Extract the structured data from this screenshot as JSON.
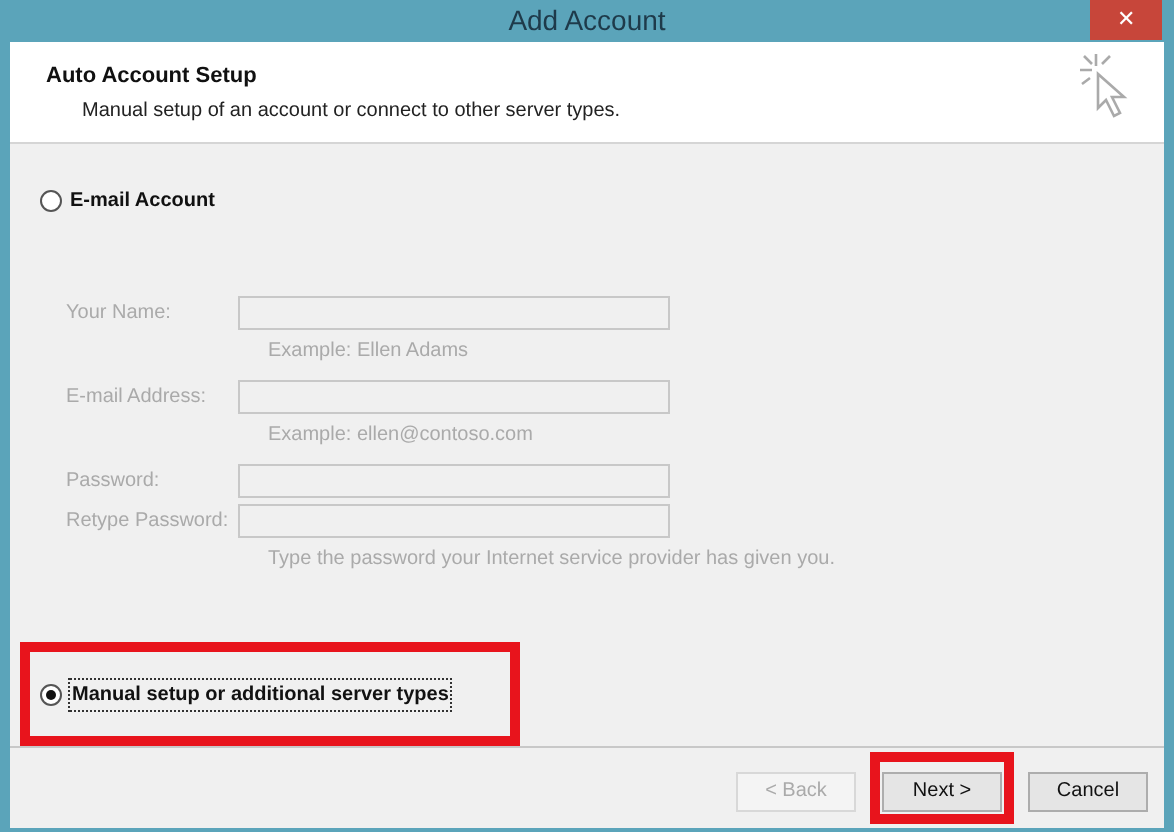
{
  "window": {
    "title": "Add Account",
    "close_label": "✕"
  },
  "header": {
    "title": "Auto Account Setup",
    "subtitle": "Manual setup of an account or connect to other server types."
  },
  "options": [
    {
      "label": "E-mail Account",
      "selected": false,
      "highlighted": false
    },
    {
      "label": "Manual setup or additional server types",
      "selected": true,
      "highlighted": true
    }
  ],
  "fields": [
    {
      "label": "Your Name:",
      "hint": "Example: Ellen Adams",
      "disabled": true
    },
    {
      "label": "E-mail Address:",
      "hint": "Example: ellen@contoso.com",
      "disabled": true
    },
    {
      "label": "Password:",
      "disabled": true
    },
    {
      "label": "Retype Password:",
      "hint": "Type the password your Internet service provider has given you.",
      "disabled": true
    }
  ],
  "buttons": [
    {
      "label": "< Back",
      "disabled": true,
      "highlighted": false
    },
    {
      "label": "Next >",
      "disabled": false,
      "highlighted": true
    },
    {
      "label": "Cancel",
      "disabled": false,
      "highlighted": false
    }
  ]
}
